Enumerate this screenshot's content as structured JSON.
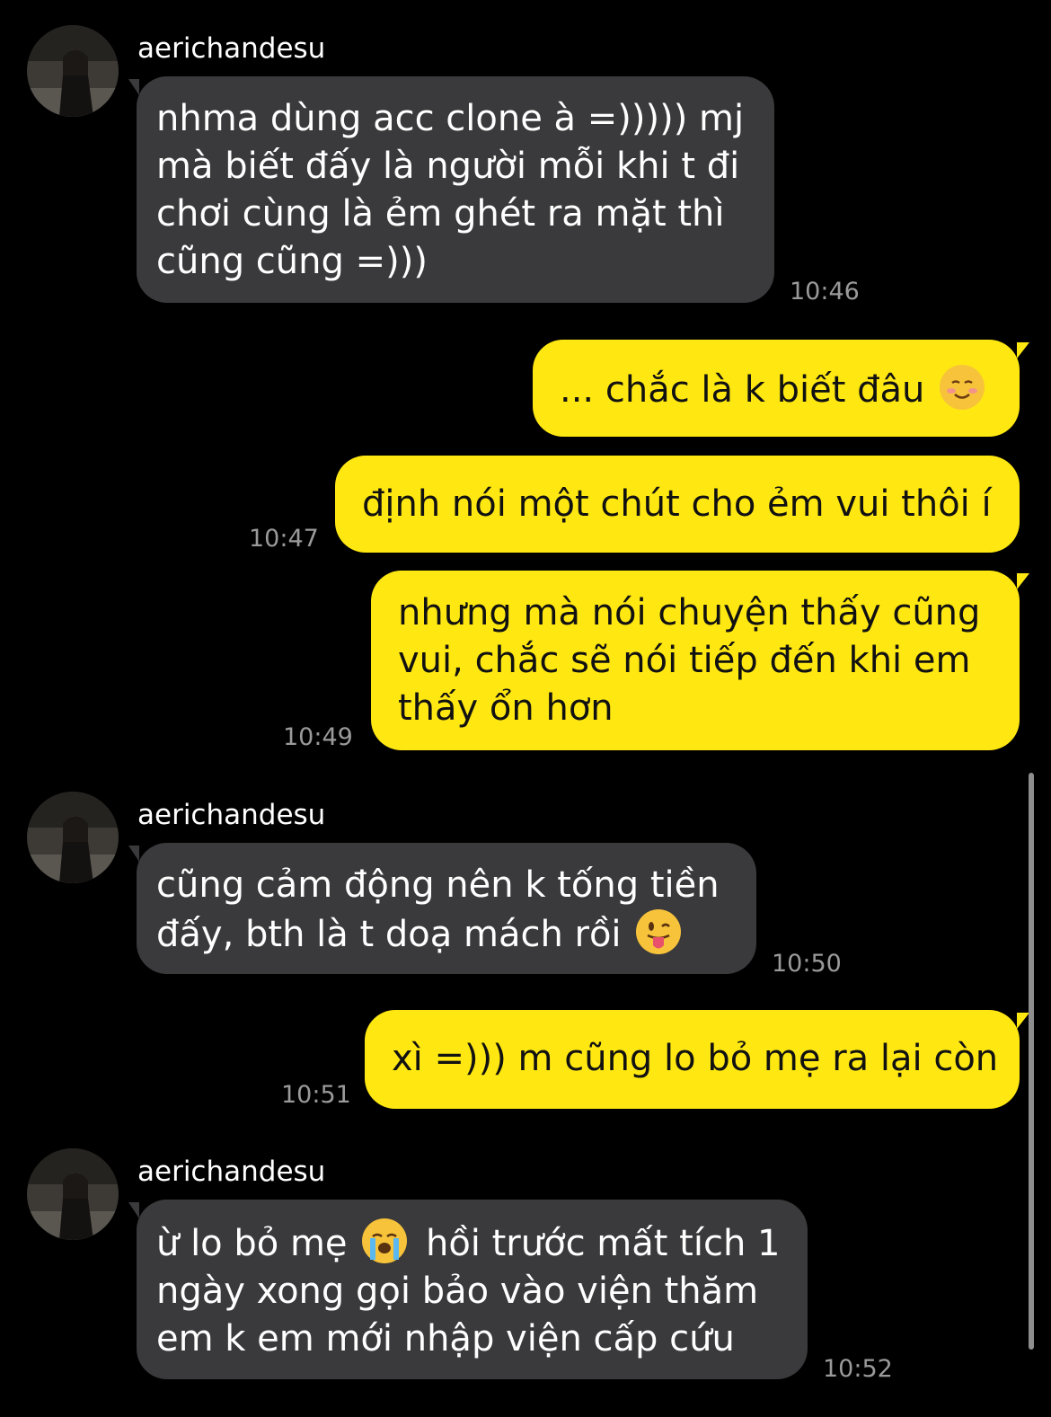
{
  "messages": [
    {
      "sender": "aerichandesu",
      "lines": [
        "nhma dùng acc clone à =))))) mj",
        "mà biết đấy là người mỗi khi t đi",
        "chơi cùng là ẻm ghét ra mặt thì",
        "cũng cũng =)))"
      ],
      "time": "10:46"
    },
    {
      "lines": [
        "... chắc là k biết đâu"
      ],
      "emoji": "smiling-face-emoji"
    },
    {
      "lines": [
        "định nói một chút cho ẻm vui thôi í"
      ],
      "time": "10:47"
    },
    {
      "lines": [
        "nhưng mà nói chuyện thấy cũng",
        "vui, chắc sẽ nói tiếp đến khi em",
        "thấy ổn hơn"
      ],
      "time": "10:49"
    },
    {
      "sender": "aerichandesu",
      "lines": [
        "cũng cảm động nên k tống tiền",
        "đấy, bth là t doạ mách rồi"
      ],
      "emoji": "tongue-out-emoji",
      "time": "10:50"
    },
    {
      "lines": [
        "xì =))) m cũng lo bỏ mẹ ra lại còn"
      ],
      "time": "10:51"
    },
    {
      "sender": "aerichandesu",
      "lines_before_emoji": "ừ lo bỏ mẹ",
      "emoji": "crying-face-emoji",
      "lines_after_emoji": "hồi trước mất tích 1",
      "lines": [
        "ngày xong gọi bảo vào viện thăm",
        "em k em mới nhập viện cấp cứu"
      ],
      "time": "10:52"
    }
  ],
  "colors": {
    "background": "#000000",
    "incoming_bubble": "#3a3a3c",
    "outgoing_bubble": "#ffe812",
    "timestamp": "#9a9a9a"
  }
}
